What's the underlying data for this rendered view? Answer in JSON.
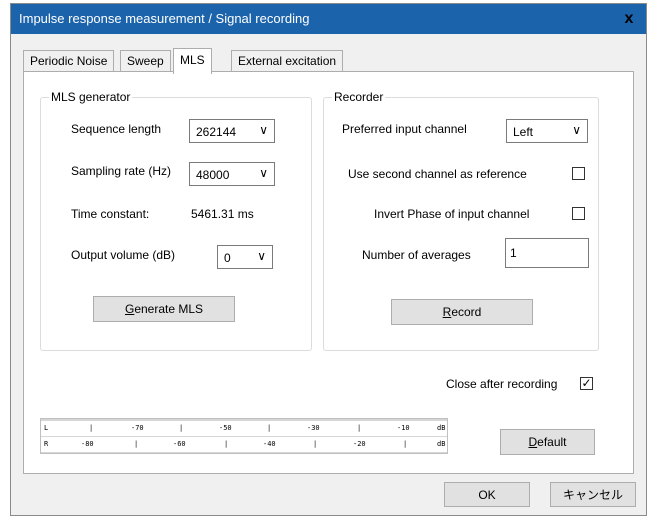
{
  "window": {
    "title": "Impulse response measurement / Signal recording",
    "close_glyph": "x"
  },
  "tabs": [
    {
      "label": "Periodic Noise"
    },
    {
      "label": "Sweep"
    },
    {
      "label": "MLS",
      "active": true
    },
    {
      "label": "External excitation"
    }
  ],
  "mls_generator": {
    "legend": "MLS generator",
    "sequence_length_label": "Sequence length",
    "sequence_length_value": "262144",
    "sampling_rate_label": "Sampling rate (Hz)",
    "sampling_rate_value": "48000",
    "time_constant_label": "Time constant:",
    "time_constant_value": "5461.31 ms",
    "output_volume_label": "Output volume (dB)",
    "output_volume_value": "0",
    "generate_button_mnemonic": "G",
    "generate_button_rest": "enerate MLS"
  },
  "recorder": {
    "legend": "Recorder",
    "preferred_input_label": "Preferred input channel",
    "preferred_input_value": "Left",
    "second_channel_label": "Use second channel as reference",
    "second_channel_checked": false,
    "invert_phase_label": "Invert Phase of input channel",
    "invert_phase_checked": false,
    "averages_label": "Number of averages",
    "averages_value": "1",
    "record_button_mnemonic": "R",
    "record_button_rest": "ecord"
  },
  "close_after": {
    "label": "Close after recording",
    "checked": true,
    "check_glyph": "✓"
  },
  "level_meter": {
    "top_row": [
      "L",
      "-70",
      "-50",
      "-30",
      "-10",
      "dB"
    ],
    "bottom_row": [
      "R",
      "-80",
      "-60",
      "-40",
      "-20",
      "dB"
    ]
  },
  "buttons": {
    "default_mnemonic": "D",
    "default_rest": "efault",
    "ok": "OK",
    "cancel": "キャンセル"
  },
  "icons": {
    "dropdown": "chevron-down-icon",
    "dropdown_glyph": "∨"
  }
}
